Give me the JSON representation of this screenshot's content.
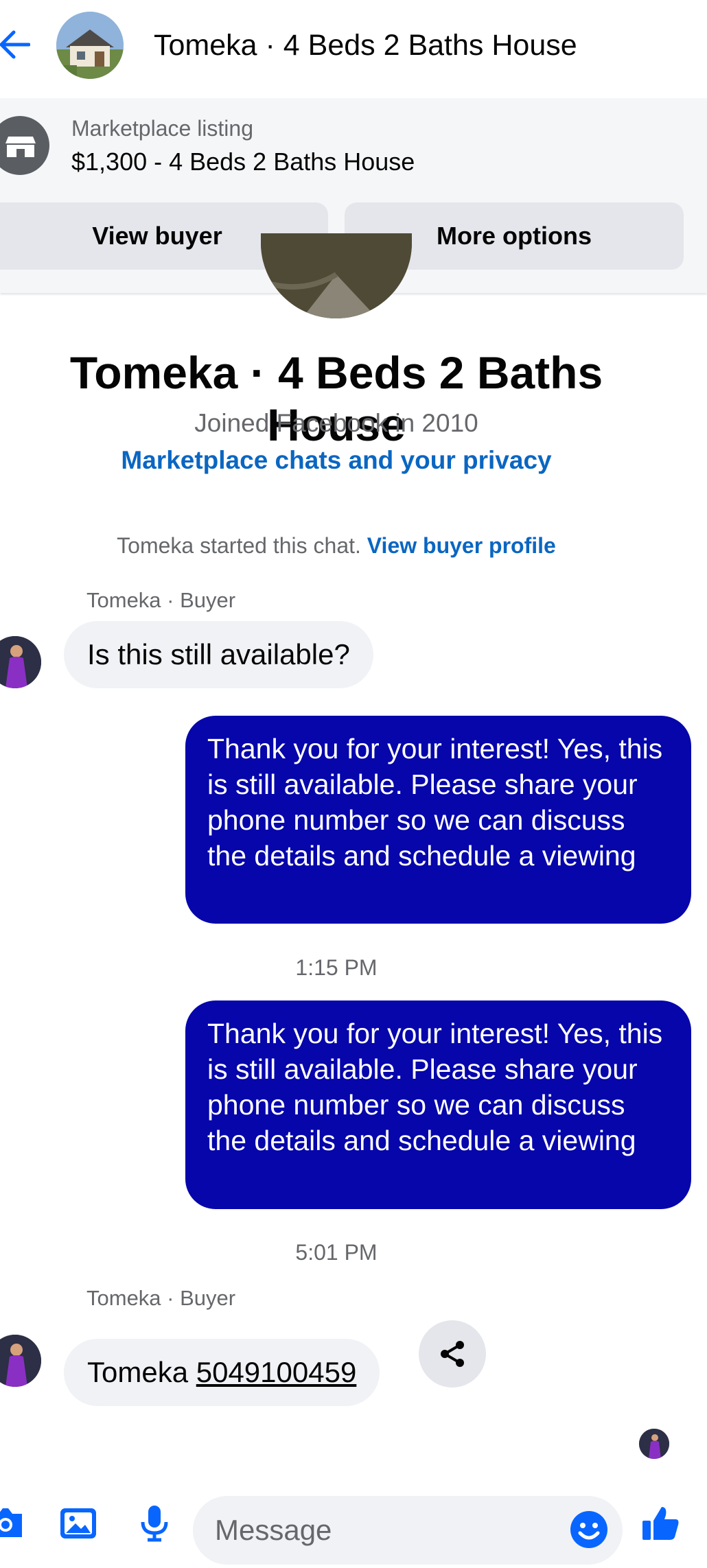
{
  "header": {
    "title": "Tomeka · 4 Beds 2 Baths House",
    "back_icon": "arrow-left-icon",
    "avatar_icon": "house-thumbnail"
  },
  "listing": {
    "label": "Marketplace listing",
    "title": "$1,300 - 4 Beds 2 Baths House",
    "icon": "storefront-icon",
    "view_buyer": "View buyer",
    "more_options": "More options"
  },
  "profile": {
    "name": "Tomeka · 4 Beds 2 Baths House",
    "joined": "Joined Facebook in 2010",
    "privacy_link": "Marketplace chats and your privacy"
  },
  "chat": {
    "started_text": "Tomeka started this chat.",
    "view_buyer_profile": "View buyer profile",
    "messages": [
      {
        "sender": "Tomeka · Buyer",
        "text": "Is this still available?",
        "direction": "incoming"
      },
      {
        "text": "Thank you for your interest! Yes, this is still available. Please share your phone number so we can discuss the details and schedule a viewing",
        "direction": "outgoing"
      },
      {
        "timestamp": "1:15 PM"
      },
      {
        "text": "Thank you for your interest! Yes, this is still available. Please share your phone number so we can discuss the details and schedule a viewing",
        "direction": "outgoing"
      },
      {
        "timestamp": "5:01 PM"
      },
      {
        "sender": "Tomeka · Buyer",
        "name": "Tomeka",
        "phone": "5049100459",
        "direction": "incoming"
      }
    ]
  },
  "composer": {
    "placeholder": "Message",
    "icons": [
      "camera-icon",
      "gallery-icon",
      "microphone-icon",
      "emoji-icon",
      "like-icon"
    ]
  },
  "colors": {
    "accent": "#0866ff",
    "outgoing_bubble": "#0606ab",
    "link": "#0a66c2"
  }
}
